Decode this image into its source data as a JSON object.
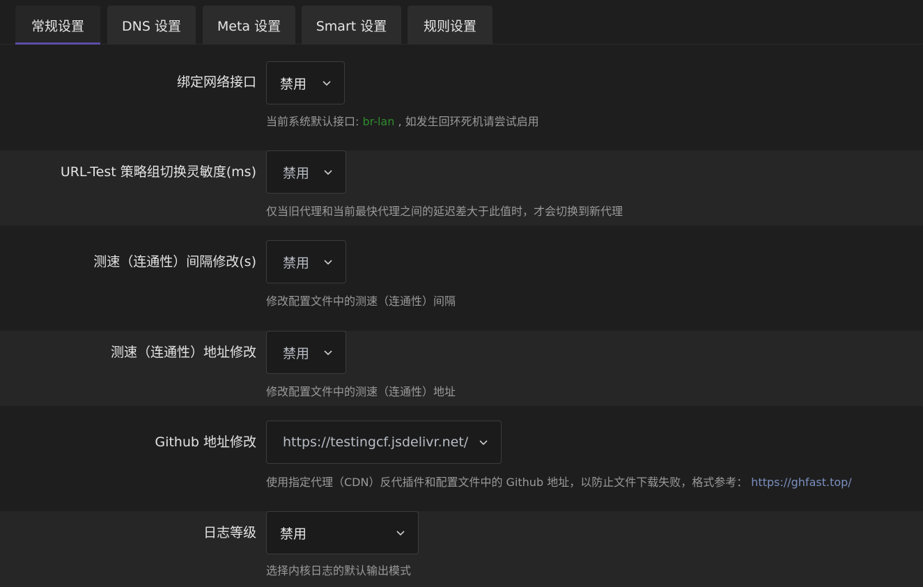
{
  "tabs": [
    {
      "label": "常规设置",
      "active": true
    },
    {
      "label": "DNS 设置",
      "active": false
    },
    {
      "label": "Meta 设置",
      "active": false
    },
    {
      "label": "Smart 设置",
      "active": false
    },
    {
      "label": "规则设置",
      "active": false
    }
  ],
  "settings": {
    "bind_interface": {
      "label": "绑定网络接口",
      "value": "禁用",
      "hint_prefix": "当前系统默认接口: ",
      "hint_iface": "br-lan",
      "hint_suffix": " , 如发生回环死机请尝试启用"
    },
    "url_test_tolerance": {
      "label": "URL-Test 策略组切换灵敏度(ms)",
      "value": "禁用",
      "hint": "仅当旧代理和当前最快代理之间的延迟差大于此值时，才会切换到新代理"
    },
    "speedtest_interval": {
      "label": "测速（连通性）间隔修改(s)",
      "value": "禁用",
      "hint": "修改配置文件中的测速（连通性）间隔"
    },
    "speedtest_url": {
      "label": "测速（连通性）地址修改",
      "value": "禁用",
      "hint": "修改配置文件中的测速（连通性）地址"
    },
    "github_url": {
      "label": "Github 地址修改",
      "value": "https://testingcf.jsdelivr.net/",
      "hint_prefix": "使用指定代理（CDN）反代插件和配置文件中的 Github 地址，以防止文件下载失败，格式参考： ",
      "hint_link": "https://ghfast.top/"
    },
    "log_level": {
      "label": "日志等级",
      "value": "禁用",
      "hint": "选择内核日志的默认输出模式"
    }
  },
  "colors": {
    "accent": "#5b4ea8",
    "interface_green": "#2e8b2e",
    "link": "#7b8fbf"
  },
  "icons": {
    "dropdown": "chevron-down-icon"
  }
}
